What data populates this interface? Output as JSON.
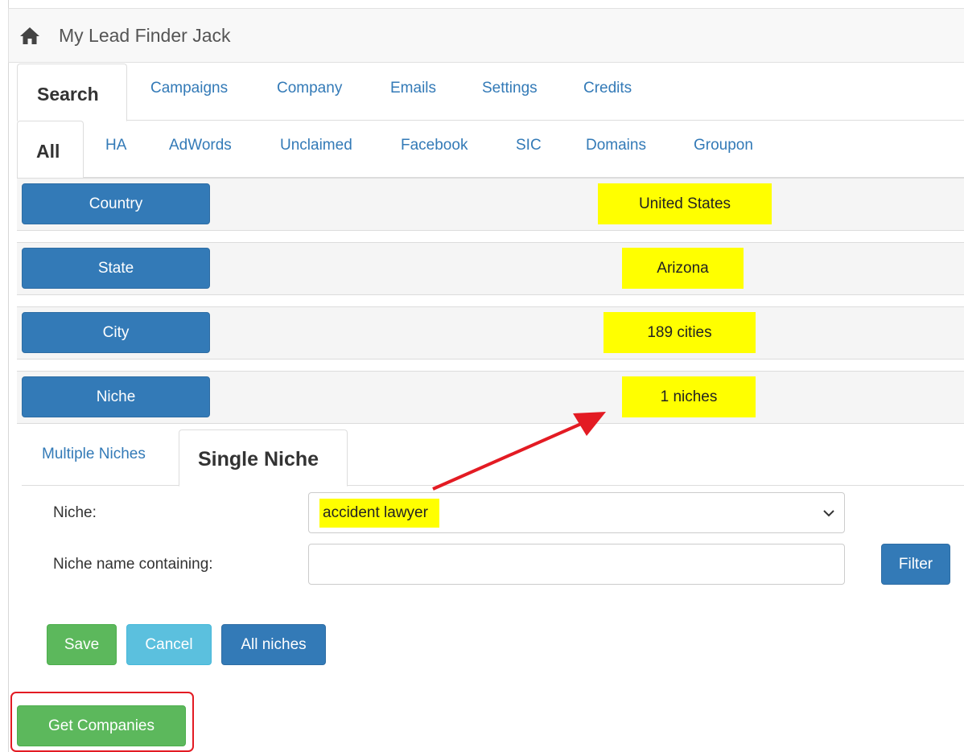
{
  "app": {
    "title": "My Lead Finder Jack",
    "home_icon": "home-icon"
  },
  "main_tabs": [
    {
      "label": "Search",
      "active": true
    },
    {
      "label": "Campaigns"
    },
    {
      "label": "Company"
    },
    {
      "label": "Emails"
    },
    {
      "label": "Settings"
    },
    {
      "label": "Credits"
    }
  ],
  "source_tabs": [
    {
      "label": "All",
      "active": true
    },
    {
      "label": "HA"
    },
    {
      "label": "AdWords"
    },
    {
      "label": "Unclaimed"
    },
    {
      "label": "Facebook"
    },
    {
      "label": "SIC"
    },
    {
      "label": "Domains"
    },
    {
      "label": "Groupon"
    }
  ],
  "filters": [
    {
      "button": "Country",
      "value": "United States"
    },
    {
      "button": "State",
      "value": "Arizona"
    },
    {
      "button": "City",
      "value": "189 cities"
    },
    {
      "button": "Niche",
      "value": "1 niches"
    }
  ],
  "niche_tabs": [
    {
      "label": "Multiple Niches"
    },
    {
      "label": "Single Niche",
      "active": true
    }
  ],
  "form": {
    "niche_label": "Niche:",
    "niche_selected": "accident lawyer",
    "contains_label": "Niche name containing:",
    "contains_value": "",
    "filter_button": "Filter"
  },
  "actions": {
    "save": "Save",
    "cancel": "Cancel",
    "all_niches": "All niches",
    "get_companies": "Get Companies"
  },
  "colors": {
    "primary": "#337ab7",
    "success": "#5cb85c",
    "info": "#5bc0de",
    "highlight": "#ffff00",
    "annotation": "#e31b23"
  }
}
